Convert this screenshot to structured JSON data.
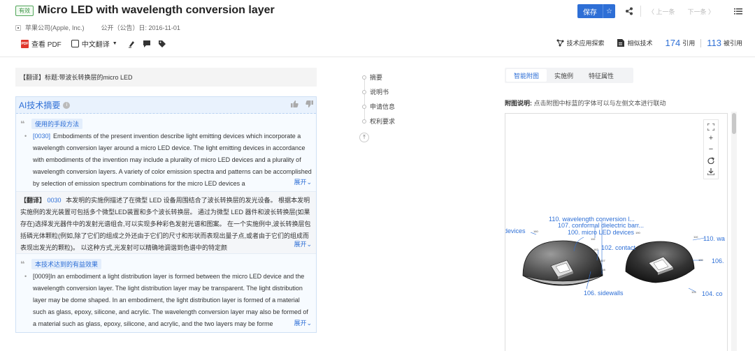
{
  "header": {
    "status": "有效",
    "title": "Micro LED with wavelength conversion layer",
    "assignee": "苹果公司(Apple, Inc.)",
    "pub_date_label": "公开（公告）日: 2016-11-01",
    "tools": {
      "pdf_badge": "PDF",
      "pdf": "查看 PDF",
      "translate": "中文翻译"
    },
    "save": "保存",
    "prev": "上一条",
    "next": "下一条",
    "explore": "技术应用探索",
    "similar": "相似技术",
    "cite_count": "174",
    "cite_label": "引用",
    "cited_count": "113",
    "cited_label": "被引用"
  },
  "left": {
    "translated_title": "【翻译】标题:带波长转换层的micro LED",
    "ai_title": "AI技术摘要",
    "section1": {
      "tag": "使用的手段方法",
      "ref": "[0030]",
      "text": "Embodiments of the present invention describe light emitting devices which incorporate a wavelength conversion layer around a micro LED device. The light emitting devices in accordance with embodiments of the invention may include a plurality of micro LED devices and a plurality of wavelength conversion layers. A variety of color emission spectra and patterns can be accomplished by selection of emission spectrum combinations for the micro LED devices a",
      "expand": "展开"
    },
    "translation": {
      "label": "【翻译】",
      "ref": "0030",
      "text": "本发明的实施例描述了在微型 LED 设备周围结合了波长转换层的发光设备。 根据本发明实施例的发光装置可包括多个微型LED装置和多个波长转换层。 通过为微型 LED 器件和波长转换层(如果存在)选择发光器件中的发射光谱组合,可以实现多种彩色发射光谱和图案。 在一个实施例中,波长转换层包括磷光体颗粒(例如,除了它们的组成之外还由于它们的尺寸和形状而表现出量子点,或者由于它们的组成而表现出发光的颗粒)。 以这种方式,光发射可以精确地调谐到色谱中的特定颜",
      "expand": "展开"
    },
    "section2": {
      "tag": "本技术达到的有益效果",
      "ref": "[0009]",
      "text": "In an embodiment a light distribution layer is formed between the micro LED device and the wavelength conversion layer. The light distribution layer may be transparent. The light distribution layer may be dome shaped. In an embodiment, the light distribution layer is formed of a material such as glass, epoxy, silicone, and acrylic. The wavelength conversion layer may also be formed of a material such as glass, epoxy, silicone, and acrylic, and the two layers may be forme",
      "expand": "展开"
    }
  },
  "nav": {
    "items": [
      "摘要",
      "说明书",
      "申请信息",
      "权利要求"
    ]
  },
  "right": {
    "tabs": [
      "智能附图",
      "实施例",
      "特征属性"
    ],
    "note_label": "附图说明:",
    "note_text": "点击附图中标蓝的字体可以与左侧文本进行联动",
    "figure_labels": {
      "l110": "110. wavelength conversion l...",
      "l107": "107. conformal dielectric barr...",
      "l100": "100. micro LED devices",
      "l102": "102. contact",
      "l106": "106. sidewalls",
      "ldev": "devices",
      "r110": "110. wa",
      "r106": "106.",
      "r104": "104. co"
    },
    "figure_small": {
      "n160": "160",
      "n110": "110",
      "n162": "162",
      "n107": "107",
      "n108": "108",
      "rn190": "190",
      "rn110": "110",
      "rn100": "100",
      "rn104": "104"
    }
  },
  "colors": {
    "accent": "#2e6fd6",
    "badge_green": "#3d9446"
  }
}
